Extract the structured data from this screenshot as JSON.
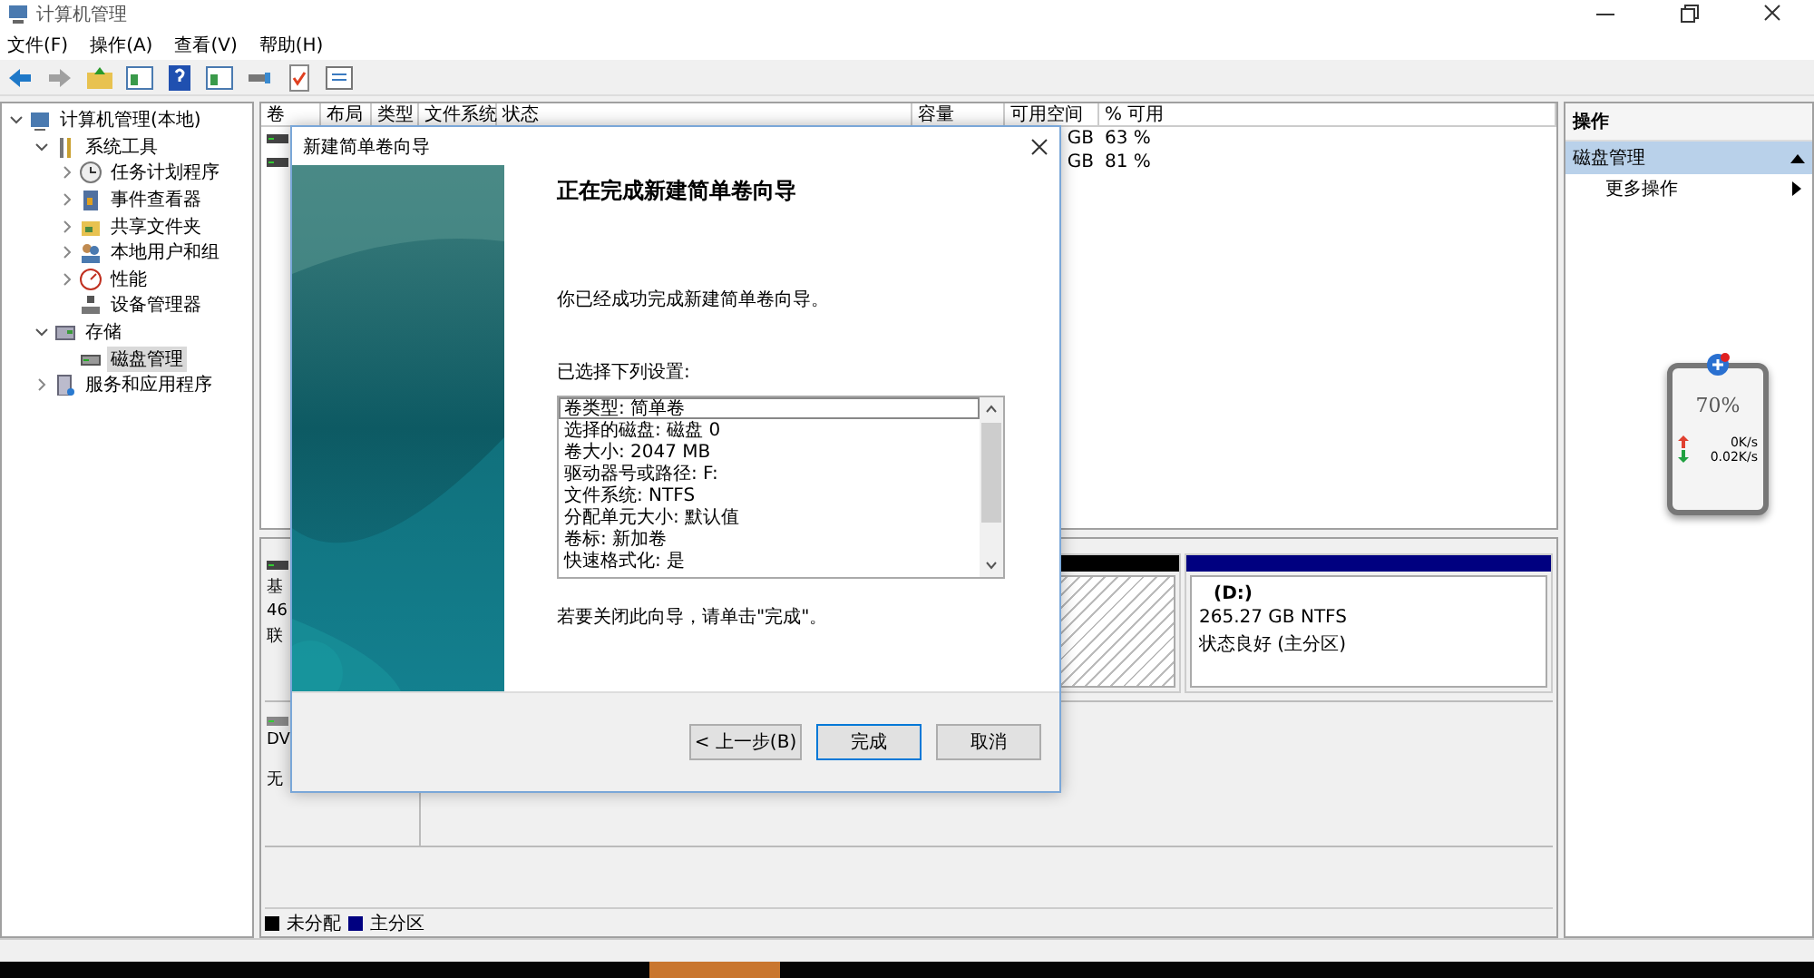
{
  "window": {
    "title": "计算机管理"
  },
  "menu": [
    "文件(F)",
    "操作(A)",
    "查看(V)",
    "帮助(H)"
  ],
  "toolbar": [
    {
      "disabled": false
    },
    {
      "disabled": true
    },
    {
      "disabled": false
    },
    {
      "disabled": false
    },
    {
      "disabled": false
    },
    {
      "disabled": false
    },
    {
      "disabled": false
    },
    {
      "disabled": false
    },
    {
      "disabled": false
    }
  ],
  "tree": [
    {
      "label": "计算机管理(本地)",
      "expanded": true,
      "selected": false,
      "children": [
        {
          "label": "系统工具",
          "expanded": true,
          "selected": false,
          "children": [
            {
              "label": "任务计划程序",
              "expanded": false,
              "selected": false
            },
            {
              "label": "事件查看器",
              "expanded": false,
              "selected": false
            },
            {
              "label": "共享文件夹",
              "expanded": false,
              "selected": false
            },
            {
              "label": "本地用户和组",
              "expanded": false,
              "selected": false
            },
            {
              "label": "性能",
              "expanded": false,
              "selected": false
            },
            {
              "label": "设备管理器",
              "selected": false
            }
          ]
        },
        {
          "label": "存储",
          "expanded": true,
          "selected": false,
          "children": [
            {
              "label": "磁盘管理",
              "selected": true
            }
          ]
        },
        {
          "label": "服务和应用程序",
          "expanded": false,
          "selected": false
        }
      ]
    }
  ],
  "volume_list": {
    "columns": [
      "卷",
      "布局",
      "类型",
      "文件系统",
      "状态",
      "容量",
      "可用空间",
      "% 可用"
    ],
    "rows": [
      {
        "free": "GB",
        "percent": "63 %"
      },
      {
        "free": "GB",
        "percent": "81 %"
      }
    ]
  },
  "disks": [
    {
      "kind": "disk",
      "label_lines": [
        "基",
        "46",
        "联"
      ],
      "partitions": [
        {
          "kind": "unallocated",
          "color": "#000000"
        },
        {
          "kind": "primary",
          "color": "#000080",
          "name": "(D:)",
          "size": "265.27 GB NTFS",
          "status": "状态良好 (主分区)"
        }
      ]
    },
    {
      "kind": "cdrom",
      "label_lines": [
        "DV",
        "无"
      ]
    }
  ],
  "legend": [
    {
      "label": "未分配",
      "color": "#000000"
    },
    {
      "label": "主分区",
      "color": "#000080"
    }
  ],
  "actions": {
    "title": "操作",
    "sections": [
      {
        "label": "磁盘管理",
        "expanded": true,
        "items": [
          "更多操作"
        ]
      }
    ]
  },
  "dialog": {
    "title": "新建简单卷向导",
    "heading": "正在完成新建简单卷向导",
    "intro": "你已经成功完成新建简单卷向导。",
    "settings_label": "已选择下列设置:",
    "settings": [
      {
        "text": "卷类型: 简单卷",
        "selected": true
      },
      {
        "text": "选择的磁盘: 磁盘 0",
        "selected": false
      },
      {
        "text": "卷大小: 2047 MB",
        "selected": false
      },
      {
        "text": "驱动器号或路径: F:",
        "selected": false
      },
      {
        "text": "文件系统: NTFS",
        "selected": false
      },
      {
        "text": "分配单元大小: 默认值",
        "selected": false
      },
      {
        "text": "卷标: 新加卷",
        "selected": false
      },
      {
        "text": "快速格式化: 是",
        "selected": false
      }
    ],
    "closing": "若要关闭此向导，请单击\"完成\"。",
    "buttons": [
      {
        "label": "< 上一步(B)",
        "default": false
      },
      {
        "label": "完成",
        "default": true
      },
      {
        "label": "取消",
        "default": false
      }
    ]
  },
  "widget": {
    "percent": "70%",
    "upload": "0K/s",
    "download": "0.02K/s"
  }
}
